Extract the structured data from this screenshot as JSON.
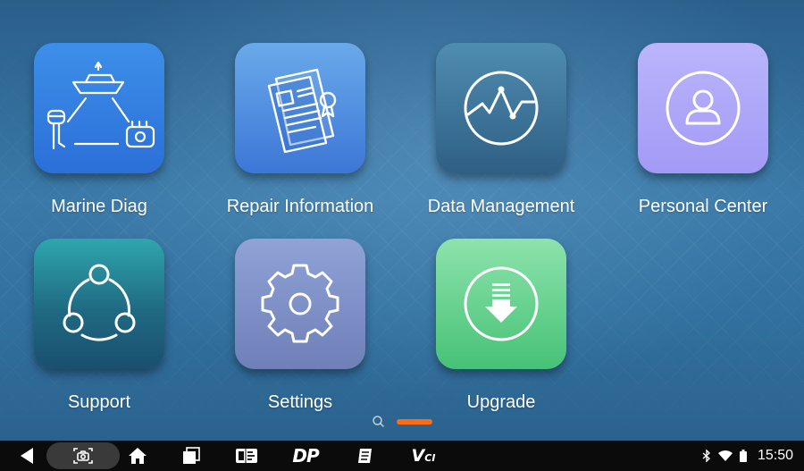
{
  "apps": [
    {
      "label": "Marine Diag",
      "icon": "marine-diag-icon",
      "color": "#2f78df"
    },
    {
      "label": "Repair Information",
      "icon": "repair-document-icon",
      "color": "#4a86dd"
    },
    {
      "label": "Data Management",
      "icon": "data-graph-icon",
      "color": "#3c7399"
    },
    {
      "label": "Personal Center",
      "icon": "person-icon",
      "color": "#ada5f8"
    },
    {
      "label": "Support",
      "icon": "share-network-icon",
      "color": "#237c8e"
    },
    {
      "label": "Settings",
      "icon": "gear-icon",
      "color": "#7e8fc6"
    },
    {
      "label": "Upgrade",
      "icon": "download-arrow-icon",
      "color": "#5ccf8a"
    }
  ],
  "pager": {
    "active_color": "#ff6a13",
    "icon": "search-icon"
  },
  "navbar": {
    "buttons": [
      "back-icon",
      "screenshot-icon",
      "home-icon",
      "recent-apps-icon",
      "remote-vehicle-icon",
      "dp-icon",
      "manual-icon",
      "vci-icon"
    ],
    "dp_label": "DP",
    "vci_label": "V",
    "vci_sub": "CI"
  },
  "status": {
    "time": "15:50",
    "icons": [
      "bluetooth-icon",
      "wifi-icon",
      "battery-icon"
    ]
  }
}
